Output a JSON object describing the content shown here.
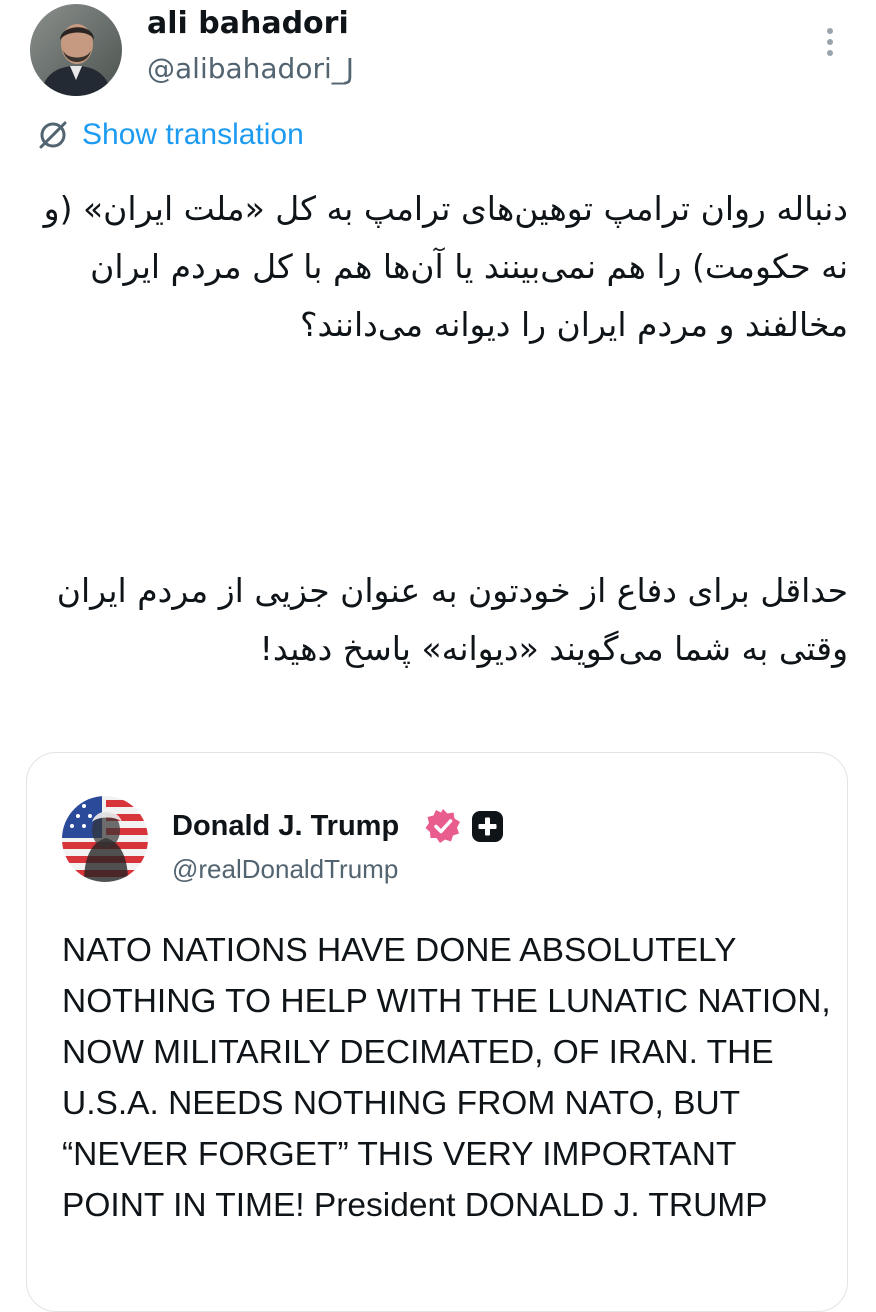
{
  "tweet": {
    "author": {
      "display_name": "ali bahadori",
      "handle": "@alibahadori_J"
    },
    "translate_label": "Show translation",
    "paragraphs": [
      "دنباله روان ترامپ توهین‌های ترامپ به کل «ملت ایران» (و نه حکومت) را هم نمی‌بینند یا آن‌ها هم با کل مردم ایران مخالفند و مردم ایران را دیوانه می‌دانند؟",
      "حداقل برای دفاع از خودتون به عنوان جزیی از مردم ایران وقتی به شما می‌گویند «دیوانه» پاسخ دهید!"
    ]
  },
  "quoted_post": {
    "author": {
      "display_name": "Donald J. Trump",
      "handle": "@realDonaldTrump"
    },
    "text": "NATO NATIONS HAVE DONE ABSOLUTELY NOTHING TO HELP WITH THE LUNATIC NATION, NOW MILITARILY DECIMATED, OF IRAN. THE U.S.A. NEEDS NOTHING FROM NATO, BUT “NEVER FORGET” THIS VERY IMPORTANT POINT IN TIME! President DONALD J. TRUMP"
  },
  "icons": {
    "more": "more-vertical-icon",
    "translate": "translate-icon",
    "verified": "verified-badge-icon",
    "plus": "plus-badge-icon"
  },
  "colors": {
    "link": "#1d9bf0",
    "secondary_text": "#536471",
    "verified_badge": "#e95c8e",
    "card_border": "#dfe4e8"
  }
}
